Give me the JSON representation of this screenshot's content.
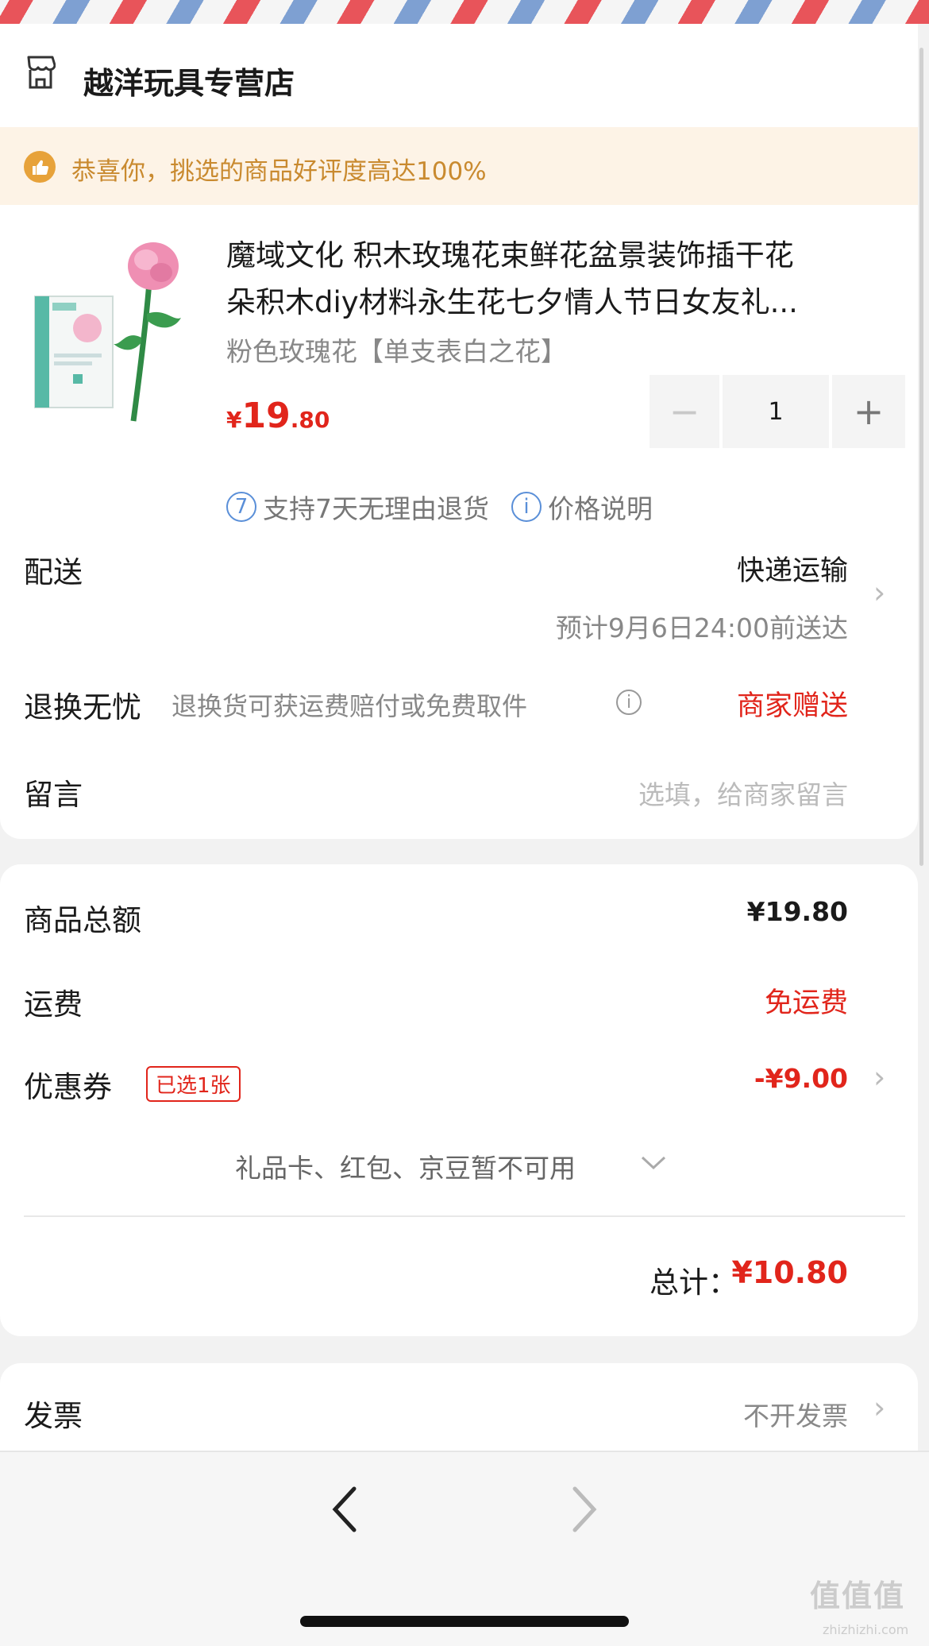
{
  "store": {
    "name": "越洋玩具专营店",
    "icon": "store-icon"
  },
  "praise": {
    "icon": "thumbs-up-icon",
    "text": "恭喜你，挑选的商品好评度高达100%"
  },
  "product": {
    "title_line1": "魔域文化 积木玫瑰花束鲜花盆景装饰插干花",
    "title_line2": "朵积木diy材料永生花七夕情人节日女友礼...",
    "spec": "粉色玫瑰花【单支表白之花】",
    "price_symbol": "¥",
    "price_int": "19",
    "price_dec": ".80",
    "quantity": "1",
    "minus": "−",
    "plus": "+",
    "return_badge": "7",
    "return_text": "支持7天无理由退货",
    "price_info_icon": "i",
    "price_info_text": "价格说明"
  },
  "delivery": {
    "label": "配送",
    "method": "快递运输",
    "eta": "预计9月6日24:00前送达"
  },
  "return_service": {
    "label": "退换无忧",
    "desc": "退换货可获运费赔付或免费取件",
    "value": "商家赠送"
  },
  "message": {
    "label": "留言",
    "placeholder": "选填，给商家留言"
  },
  "summary": {
    "goods_label": "商品总额",
    "goods_value": "¥19.80",
    "shipping_label": "运费",
    "shipping_value": "免运费",
    "coupon_label": "优惠券",
    "coupon_badge": "已选1张",
    "coupon_value": "-¥9.00",
    "unavailable": "礼品卡、红包、京豆暂不可用",
    "total_label": "总计：",
    "total_value": "¥10.80"
  },
  "invoice": {
    "label": "发票",
    "value": "不开发票"
  },
  "nav": {
    "back": "‹",
    "forward": "›"
  },
  "watermark": {
    "text": "值值值",
    "url": "zhizhizhi.com"
  },
  "colors": {
    "accent": "#e1251b",
    "praise": "#c98a2f",
    "link_blue": "#5a8fd8"
  }
}
